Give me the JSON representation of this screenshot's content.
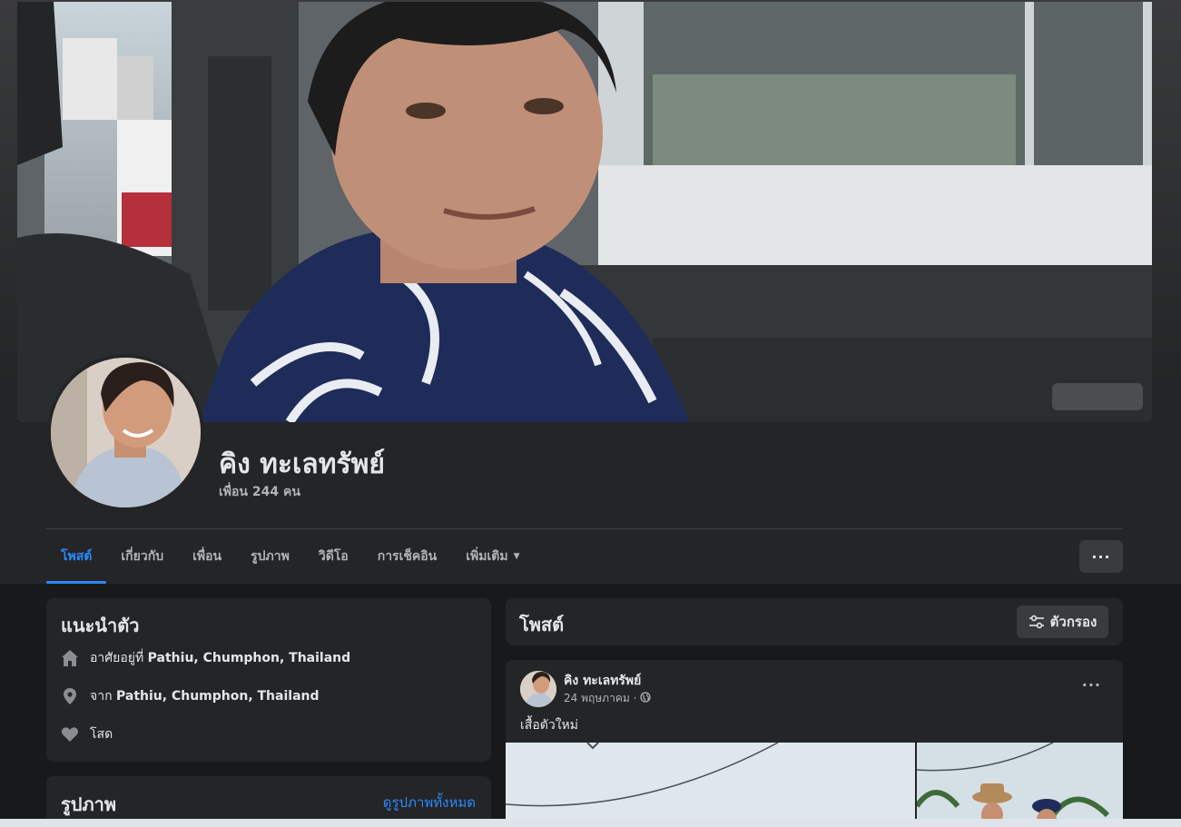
{
  "profile": {
    "name": "คิง ทะเลทรัพย์",
    "friends": "เพื่อน 244 คน"
  },
  "tabs": [
    {
      "label": "โพสต์",
      "active": true
    },
    {
      "label": "เกี่ยวกับ",
      "active": false
    },
    {
      "label": "เพื่อน",
      "active": false
    },
    {
      "label": "รูปภาพ",
      "active": false
    },
    {
      "label": "วิดีโอ",
      "active": false
    },
    {
      "label": "การเช็คอิน",
      "active": false
    },
    {
      "label": "เพิ่มเติม",
      "active": false
    }
  ],
  "more_button": "···",
  "intro": {
    "title": "แนะนำตัว",
    "lives_prefix": "อาศัยอยู่ที่",
    "lives_place": "Pathiu, Chumphon, Thailand",
    "from_prefix": "จาก",
    "from_place": "Pathiu, Chumphon, Thailand",
    "relationship": "โสด"
  },
  "photos": {
    "title": "รูปภาพ",
    "see_all": "ดูรูปภาพทั้งหมด"
  },
  "posts": {
    "title": "โพสต์",
    "filter_label": "ตัวกรอง"
  },
  "post": {
    "author": "คิง ทะเลทรัพย์",
    "date": "24 พฤษภาคม ·",
    "text": "เสื้อตัวใหม่",
    "menu": "···"
  },
  "colors": {
    "accent": "#2d88ff",
    "card": "#242526",
    "background": "#18191a"
  },
  "icons": {
    "home": "home-icon",
    "location": "location-pin-icon",
    "heart": "heart-icon",
    "filter": "filter-sliders-icon",
    "globe": "globe-icon",
    "caret": "caret-down-icon"
  }
}
